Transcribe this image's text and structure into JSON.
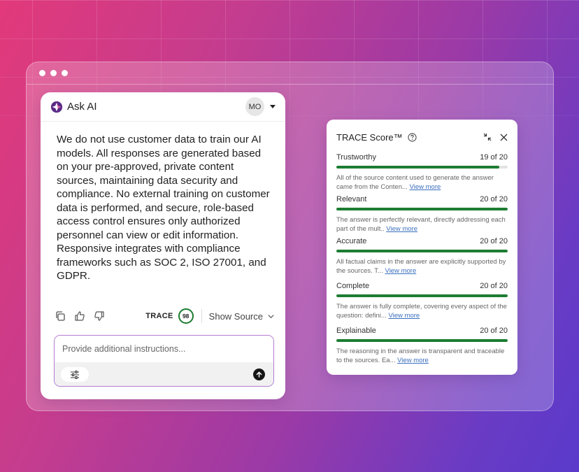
{
  "window": {
    "dots": 3
  },
  "ask_ai": {
    "title": "Ask AI",
    "avatar_initials": "MO",
    "answer": "We do not use customer data to train our AI models. All responses are generated based on your pre-approved, private content sources, maintaining data security and compliance. No external training on customer data is performed, and secure, role-based access control ensures only authorized personnel can view or edit information. Responsive integrates with compliance frameworks such as SOC 2, ISO 27001, and GDPR.",
    "trace_label": "TRACE",
    "trace_score": "98",
    "trace_score_fraction": 0.98,
    "show_source_label": "Show Source",
    "prompt_placeholder": "Provide additional instructions...",
    "icons": [
      "copy-icon",
      "thumbs-up-icon",
      "thumbs-down-icon",
      "filter-sliders-icon",
      "send-arrow-icon"
    ],
    "accent_color": "#b47cd2"
  },
  "trace": {
    "title": "TRACE Score™",
    "score_color": "#1d7d32",
    "view_more_label": "View more",
    "metrics": [
      {
        "name": "Trustworthy",
        "score": "19 of 20",
        "fraction": 0.95,
        "desc": "All of the source content used to generate the answer came from the Conten..."
      },
      {
        "name": "Relevant",
        "score": "20 of 20",
        "fraction": 1.0,
        "desc": "The answer is perfectly relevant, directly addressing each part of the mult.."
      },
      {
        "name": "Accurate",
        "score": "20 of 20",
        "fraction": 1.0,
        "desc": "All factual claims in the answer are explicitly supported by the sources. T..."
      },
      {
        "name": "Complete",
        "score": "20 of 20",
        "fraction": 1.0,
        "desc": "The answer is fully complete, covering every aspect of the question: defini..."
      },
      {
        "name": "Explainable",
        "score": "20 of 20",
        "fraction": 1.0,
        "desc": "The reasoning in the answer is transparent and traceable to the sources. Ea..."
      }
    ]
  }
}
